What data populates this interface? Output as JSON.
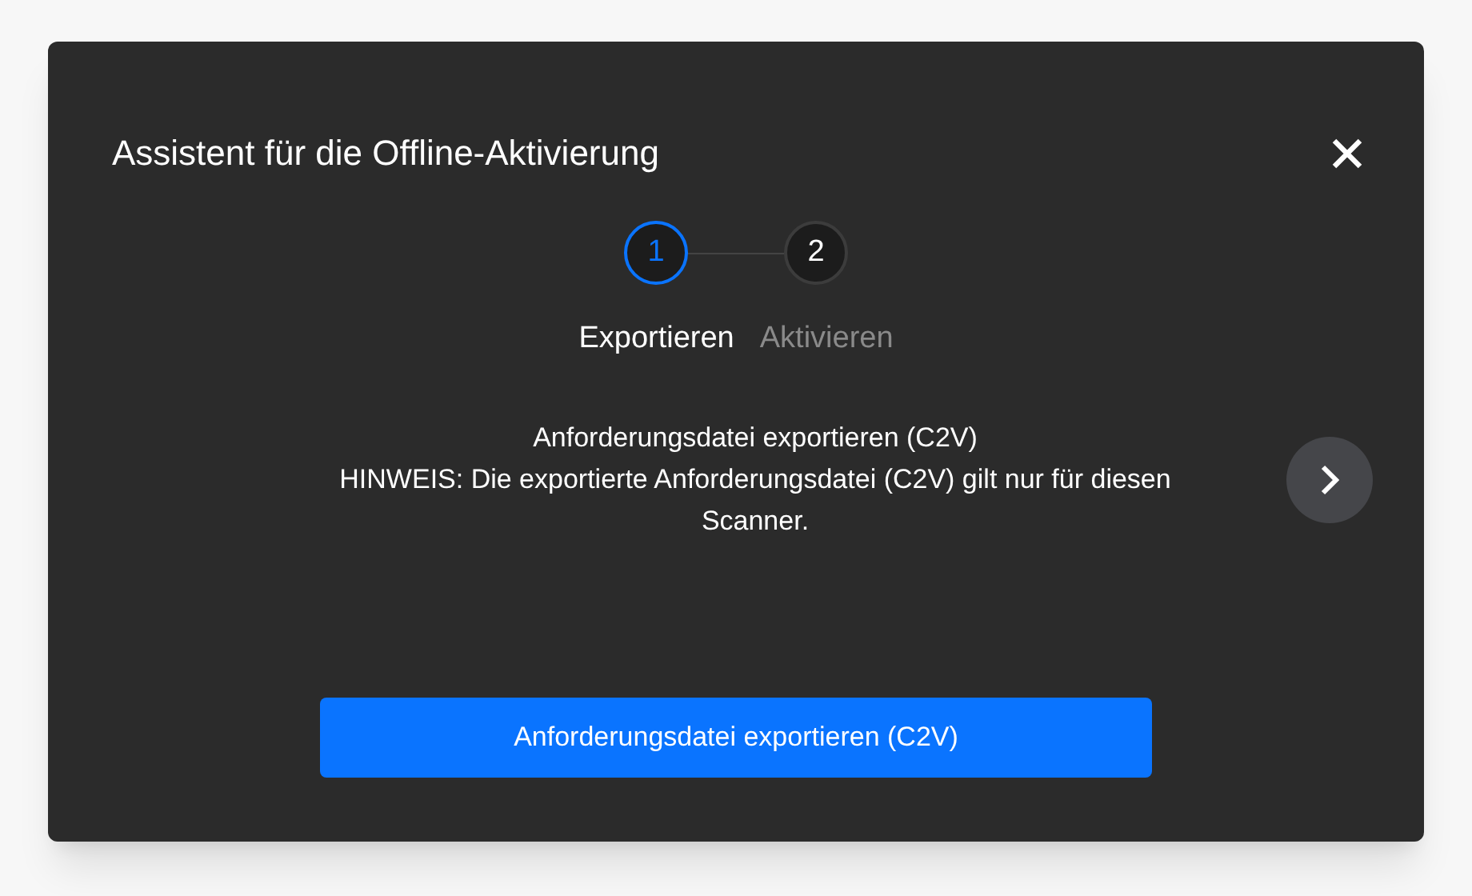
{
  "dialog": {
    "title": "Assistent für die Offline-Aktivierung"
  },
  "steps": [
    {
      "number": "1",
      "label": "Exportieren",
      "selected": true
    },
    {
      "number": "2",
      "label": "Aktivieren",
      "selected": false
    }
  ],
  "message": {
    "heading": "Anforderungsdatei exportieren (C2V)",
    "note": "HINWEIS: Die exportierte Anforderungsdatei (C2V) gilt nur für diesen Scanner."
  },
  "primary_button": "Anforderungsdatei exportieren (C2V)"
}
